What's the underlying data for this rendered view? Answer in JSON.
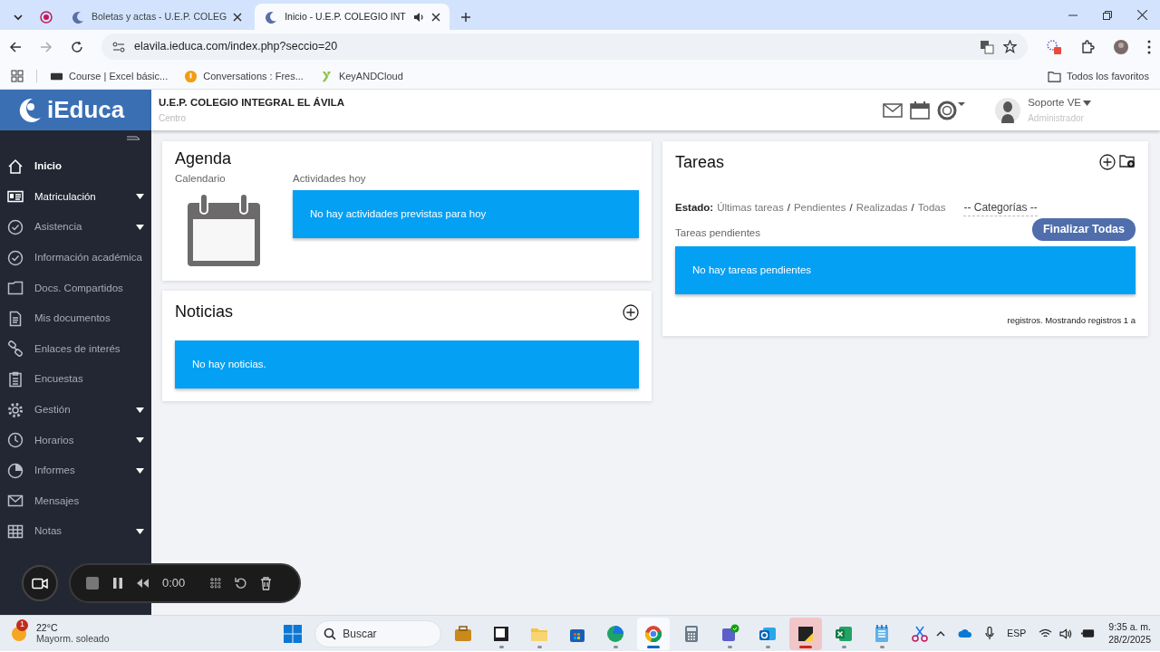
{
  "browser": {
    "tabs": [
      {
        "title": "Boletas y actas - U.E.P. COLEG",
        "selected": false,
        "audio": false
      },
      {
        "title": "Inicio - U.E.P. COLEGIO INT",
        "selected": true,
        "audio": true
      }
    ],
    "url": "elavila.ieduca.com/index.php?seccio=20",
    "bookmarks": [
      {
        "label": "Course | Excel básic...",
        "kind": "course"
      },
      {
        "label": "Conversations : Fres...",
        "kind": "chat"
      },
      {
        "label": "KeyANDCloud",
        "kind": "key"
      }
    ],
    "all_bookmarks": "Todos los favoritos"
  },
  "app": {
    "logo": "iEduca",
    "school": "U.E.P. COLEGIO INTEGRAL EL ÁVILA",
    "school_sub": "Centro",
    "user_name": "Soporte VE",
    "user_role": "Administrador"
  },
  "sidebar": {
    "items": [
      {
        "label": "Inicio",
        "kind": "home",
        "selected": true,
        "hovered": false,
        "submenu": false
      },
      {
        "label": "Matriculación",
        "kind": "card",
        "selected": false,
        "hovered": true,
        "submenu": true
      },
      {
        "label": "Asistencia",
        "kind": "check",
        "selected": false,
        "hovered": false,
        "submenu": true
      },
      {
        "label": "Información académica",
        "kind": "check",
        "selected": false,
        "hovered": false,
        "submenu": false
      },
      {
        "label": "Docs. Compartidos",
        "kind": "folder",
        "selected": false,
        "hovered": false,
        "submenu": false
      },
      {
        "label": "Mis documentos",
        "kind": "document",
        "selected": false,
        "hovered": false,
        "submenu": false
      },
      {
        "label": "Enlaces de interés",
        "kind": "link",
        "selected": false,
        "hovered": false,
        "submenu": false
      },
      {
        "label": "Encuestas",
        "kind": "clipboard",
        "selected": false,
        "hovered": false,
        "submenu": false
      },
      {
        "label": "Gestión",
        "kind": "gear",
        "selected": false,
        "hovered": false,
        "submenu": true
      },
      {
        "label": "Horarios",
        "kind": "clock",
        "selected": false,
        "hovered": false,
        "submenu": true
      },
      {
        "label": "Informes",
        "kind": "pie",
        "selected": false,
        "hovered": false,
        "submenu": true
      },
      {
        "label": "Mensajes",
        "kind": "mail",
        "selected": false,
        "hovered": false,
        "submenu": false
      },
      {
        "label": "Notas",
        "kind": "grid",
        "selected": false,
        "hovered": false,
        "submenu": true
      }
    ]
  },
  "agenda": {
    "title": "Agenda",
    "calendar_label": "Calendario",
    "activities_label": "Actividades hoy",
    "activities_message": "No hay actividades previstas para hoy"
  },
  "news": {
    "title": "Noticias",
    "message": "No hay noticias."
  },
  "tasks": {
    "title": "Tareas",
    "state_label": "Estado:",
    "filters": [
      "Últimas tareas",
      "Pendientes",
      "Realizadas",
      "Todas"
    ],
    "separator": "/",
    "category": "-- Categorías --",
    "finish_button": "Finalizar Todas",
    "subtitle": "Tareas pendientes",
    "message": "No hay tareas pendientes",
    "footer": "registros. Mostrando registros 1 a"
  },
  "recorder": {
    "time": "0:00"
  },
  "taskbar": {
    "weather": {
      "badge": "1",
      "temperature": "22°C",
      "description": "Mayorm. soleado"
    },
    "search": {
      "placeholder": "Buscar"
    },
    "apps": [
      {
        "kind": "briefcase",
        "running": false,
        "focused": false,
        "flashing": false
      },
      {
        "kind": "terminal",
        "running": true,
        "focused": false,
        "flashing": false
      },
      {
        "kind": "folder",
        "running": true,
        "focused": false,
        "flashing": false
      },
      {
        "kind": "store",
        "running": false,
        "focused": false,
        "flashing": false
      },
      {
        "kind": "edge",
        "running": true,
        "focused": false,
        "flashing": false
      },
      {
        "kind": "chrome",
        "running": true,
        "focused": true,
        "flashing": false
      },
      {
        "kind": "calculator",
        "running": false,
        "focused": false,
        "flashing": false
      },
      {
        "kind": "teams",
        "running": true,
        "focused": false,
        "flashing": false
      },
      {
        "kind": "mail",
        "running": true,
        "focused": false,
        "flashing": false
      },
      {
        "kind": "sticky",
        "running": true,
        "focused": false,
        "flashing": true
      },
      {
        "kind": "excel",
        "running": true,
        "focused": false,
        "flashing": false
      },
      {
        "kind": "notepad",
        "running": true,
        "focused": false,
        "flashing": false
      },
      {
        "kind": "snip",
        "running": false,
        "focused": false,
        "flashing": false
      }
    ],
    "language": "ESP",
    "time": "9:35 a. m.",
    "date": "28/2/2025"
  }
}
